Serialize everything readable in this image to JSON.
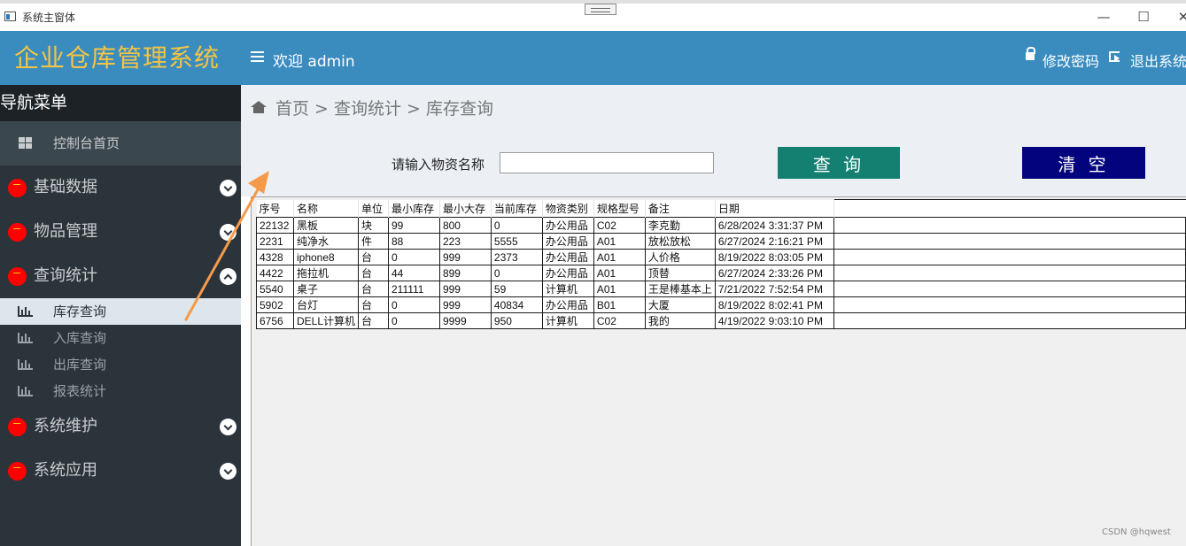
{
  "window": {
    "title": "系统主窗体",
    "minimize": "—",
    "maximize": "☐",
    "close": "✕"
  },
  "sidebar": {
    "brand": "企业仓库管理系统",
    "nav_header": "导航菜单",
    "top_item": "控制台首页",
    "groups": [
      {
        "label": "基础数据",
        "expanded": false
      },
      {
        "label": "物品管理",
        "expanded": false
      },
      {
        "label": "查询统计",
        "expanded": true,
        "children": [
          "库存查询",
          "入库查询",
          "出库查询",
          "报表统计"
        ],
        "active_child": "库存查询"
      },
      {
        "label": "系统维护",
        "expanded": false
      },
      {
        "label": "系统应用",
        "expanded": false
      }
    ]
  },
  "header": {
    "welcome": "欢迎 admin",
    "change_password": "修改密码",
    "logout": "退出系统"
  },
  "breadcrumb": "首页 > 查询统计 > 库存查询",
  "search": {
    "label": "请输入物资名称",
    "value": "",
    "query_button": "查 询",
    "clear_button": "清 空"
  },
  "grid": {
    "columns": [
      "序号",
      "名称",
      "单位",
      "最小库存",
      "最小大存",
      "当前库存",
      "物资类别",
      "规格型号",
      "备注",
      "日期"
    ],
    "rows": [
      [
        "22132",
        "黑板",
        "块",
        "99",
        "800",
        "0",
        "办公用品",
        "C02",
        "李克勤",
        "6/28/2024 3:31:37 PM"
      ],
      [
        "2231",
        "纯净水",
        "件",
        "88",
        "223",
        "5555",
        "办公用品",
        "A01",
        "放松放松",
        "6/27/2024 2:16:21 PM"
      ],
      [
        "4328",
        "iphone8",
        "台",
        "0",
        "999",
        "2373",
        "办公用品",
        "A01",
        "人价格",
        "8/19/2022 8:03:05 PM"
      ],
      [
        "4422",
        "拖拉机",
        "台",
        "44",
        "899",
        "0",
        "办公用品",
        "A01",
        "顶替",
        "6/27/2024 2:33:26 PM"
      ],
      [
        "5540",
        "桌子",
        "台",
        "211111",
        "999",
        "59",
        "计算机",
        "A01",
        "王是棒基本上",
        "7/21/2022 7:52:54 PM"
      ],
      [
        "5902",
        "台灯",
        "台",
        "0",
        "999",
        "40834",
        "办公用品",
        "B01",
        "大厦",
        "8/19/2022 8:02:41 PM"
      ],
      [
        "6756",
        "DELL计算机",
        "台",
        "0",
        "9999",
        "950",
        "计算机",
        "C02",
        "我的",
        "4/19/2022 9:03:10 PM"
      ]
    ]
  },
  "watermark": "CSDN @hqwest",
  "colors": {
    "header_blue": "#3a8cbf",
    "brand_text": "#f5c443",
    "sidebar_bg": "#2b343a",
    "query_button": "#138072",
    "clear_button": "#03047d",
    "annotation_arrow": "#f59a4a"
  }
}
